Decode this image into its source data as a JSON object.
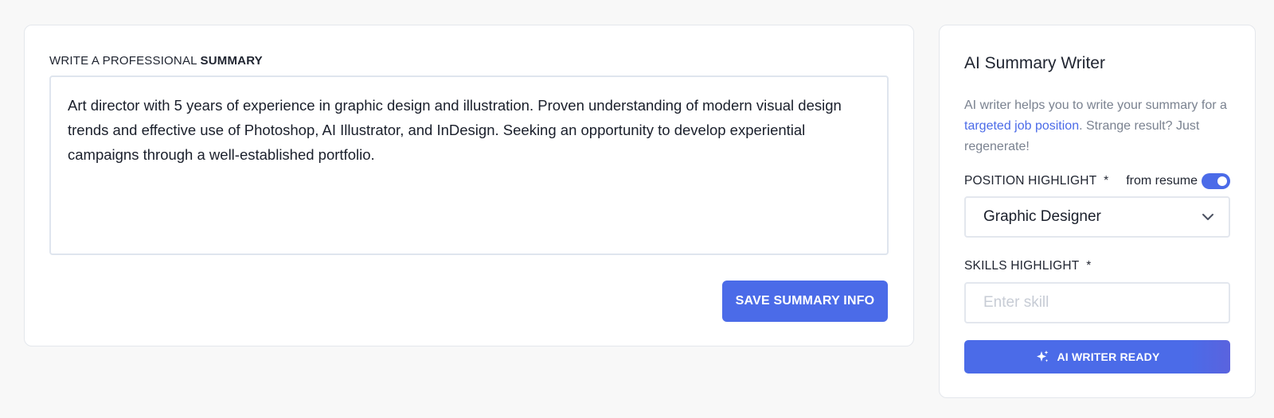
{
  "summary": {
    "heading_prefix": "WRITE A PROFESSIONAL ",
    "heading_bold": "SUMMARY",
    "text": "Art director with 5 years of experience in graphic design and illustration. Proven understanding of modern visual design trends and effective use of Photoshop, AI Illustrator, and InDesign. Seeking an opportunity to develop experiential campaigns through a well-established portfolio.",
    "save_label": "SAVE SUMMARY INFO"
  },
  "ai_writer": {
    "title": "AI Summary Writer",
    "desc_before": "AI writer helps you to write your summary for a ",
    "desc_link": "targeted job position",
    "desc_after": ". Strange result? Just regenerate!",
    "position_label": "POSITION HIGHLIGHT  *",
    "from_resume_label": "from resume",
    "from_resume_enabled": true,
    "position_value": "Graphic Designer",
    "skills_label": "SKILLS HIGHLIGHT  *",
    "skills_placeholder": "Enter skill",
    "skills_value": "",
    "button_label": "AI WRITER READY",
    "button_icon": "sparkle-icon",
    "select_icon": "chevron-down-icon"
  },
  "colors": {
    "accent": "#4b6be8",
    "page_bg": "#f8f8f8",
    "muted_text": "#7a8290",
    "border": "#e3e7ee"
  }
}
